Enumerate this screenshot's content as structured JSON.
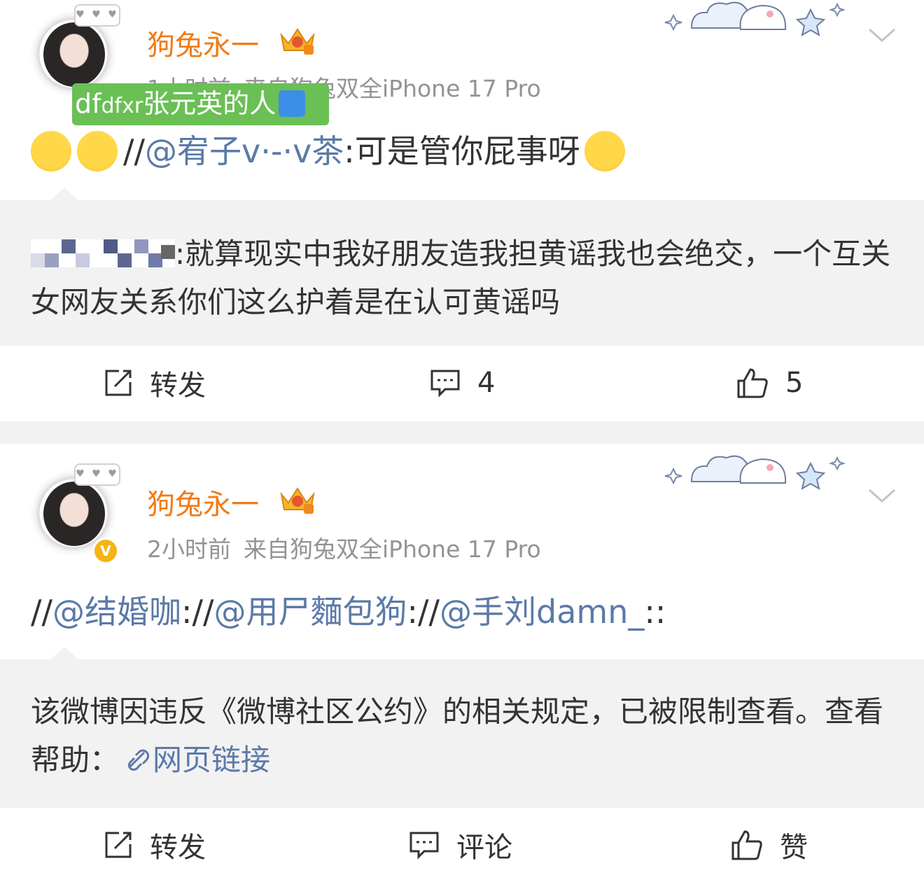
{
  "posts": [
    {
      "username": "狗兔永一",
      "time": "1小时前",
      "source": "来自狗兔双全iPhone 17 Pro",
      "avatar_bubble": "♥ ♥ ♥",
      "overlay_label": "df",
      "overlay_label_small": "dfxr",
      "overlay_label_rest": "张元英的人",
      "content_prefix": "//",
      "content_mention": "@宥子v·-·v茶",
      "content_text": ":可是管你屁事呀",
      "repost_text": ":就算现实中我好朋友造我担黄谣我也会绝交，一个互关女网友关系你们这么护着是在认可黄谣吗",
      "actions": {
        "repost": "转发",
        "comment": "4",
        "like": "5"
      }
    },
    {
      "username": "狗兔永一",
      "time": "2小时前",
      "source": "来自狗兔双全iPhone 17 Pro",
      "avatar_bubble": "♥ ♥ ♥",
      "verified_badge": "V",
      "content_parts": {
        "s1": "//",
        "m1": "@结婚咖",
        "s2": "://",
        "m2": "@用尸麵包狗",
        "s3": "://",
        "m3": "@手刘damn_",
        "s4": "::"
      },
      "repost_text": "该微博因违反《微博社区公约》的相关规定，已被限制查看。查看帮助：",
      "repost_link": "网页链接",
      "actions": {
        "repost": "转发",
        "comment": "评论",
        "like": "赞"
      }
    }
  ],
  "colors": {
    "username": "#f27b14",
    "mention": "#5b7aa7",
    "meta": "#939393",
    "overlay_green": "#6abf55",
    "repost_bg": "#f2f2f2"
  },
  "icons": [
    "crown-badge-icon",
    "chevron-down-icon",
    "repost-icon",
    "comment-icon",
    "like-icon",
    "link-icon",
    "verified-icon"
  ]
}
